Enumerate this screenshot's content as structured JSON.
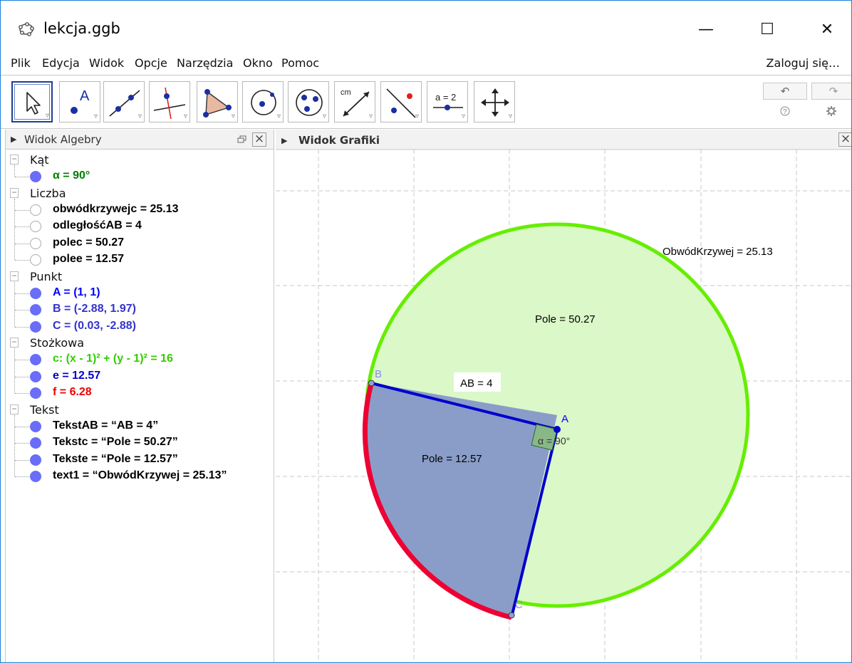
{
  "window": {
    "title": "lekcja.ggb",
    "minimize": "—",
    "maximize": "☐",
    "close": "✕"
  },
  "menu": {
    "items": [
      "Plik",
      "Edycja",
      "Widok",
      "Opcje",
      "Narzędzia",
      "Okno",
      "Pomoc"
    ],
    "login": "Zaloguj się…"
  },
  "toolbar": {
    "tools": [
      {
        "icon": "move-pointer-icon",
        "active": true
      },
      {
        "icon": "point-icon",
        "label": "A"
      },
      {
        "icon": "line-icon"
      },
      {
        "icon": "perpendicular-line-icon"
      },
      {
        "icon": "polygon-icon"
      },
      {
        "icon": "circle-center-point-icon"
      },
      {
        "icon": "circle-three-points-icon"
      },
      {
        "icon": "distance-icon",
        "label": "cm"
      },
      {
        "icon": "reflect-icon"
      },
      {
        "icon": "slider-icon",
        "label": "a = 2"
      },
      {
        "icon": "move-graphics-view-icon"
      }
    ],
    "undo": "↶",
    "redo": "↷"
  },
  "algebra": {
    "title": "Widok Algebry",
    "groups": [
      {
        "name": "Kąt",
        "items": [
          {
            "text": "α = 90°",
            "color": "#007f00",
            "visible": true
          }
        ]
      },
      {
        "name": "Liczba",
        "items": [
          {
            "text": "obwódkrzywejc = 25.13",
            "color": "#000000",
            "visible": false
          },
          {
            "text": "odległośćAB = 4",
            "color": "#000000",
            "visible": false
          },
          {
            "text": "polec = 50.27",
            "color": "#000000",
            "visible": false
          },
          {
            "text": "polee = 12.57",
            "color": "#000000",
            "visible": false
          }
        ]
      },
      {
        "name": "Punkt",
        "items": [
          {
            "text": "A = (1, 1)",
            "color": "#0000ff",
            "visible": true
          },
          {
            "text": "B = (-2.88, 1.97)",
            "color": "#3333cc",
            "visible": true
          },
          {
            "text": "C = (0.03, -2.88)",
            "color": "#3333cc",
            "visible": true
          }
        ]
      },
      {
        "name": "Stożkowa",
        "items": [
          {
            "text": "c: (x - 1)² + (y - 1)² = 16",
            "color": "#33cc00",
            "visible": true
          },
          {
            "text": "e = 12.57",
            "color": "#0000cc",
            "visible": true
          },
          {
            "text": "f = 6.28",
            "color": "#ee0000",
            "visible": true
          }
        ]
      },
      {
        "name": "Tekst",
        "items": [
          {
            "text": "TekstAB = “AB = 4”",
            "color": "#000000",
            "visible": true
          },
          {
            "text": "Tekstc = “Pole = 50.27”",
            "color": "#000000",
            "visible": true
          },
          {
            "text": "Tekste = “Pole = 12.57”",
            "color": "#000000",
            "visible": true
          },
          {
            "text": "text1 = “ObwódKrzywej = 25.13”",
            "color": "#000000",
            "visible": true
          }
        ]
      }
    ]
  },
  "graphics": {
    "title": "Widok Grafiki",
    "labels": {
      "A": "A",
      "B": "B",
      "C": "C",
      "angle": "α = 90°",
      "ab": "AB = 4",
      "pole_c": "Pole = 50.27",
      "pole_e": "Pole = 12.57",
      "obwod": "ObwódKrzywej = 25.13"
    },
    "colors": {
      "circle": "#66ee00",
      "circle_fill": "#dbf8c8",
      "arc": "#ee0033",
      "sector_fill": "#8a9dc8",
      "segment": "#0000cc",
      "angle_fill": "#88b888"
    }
  }
}
